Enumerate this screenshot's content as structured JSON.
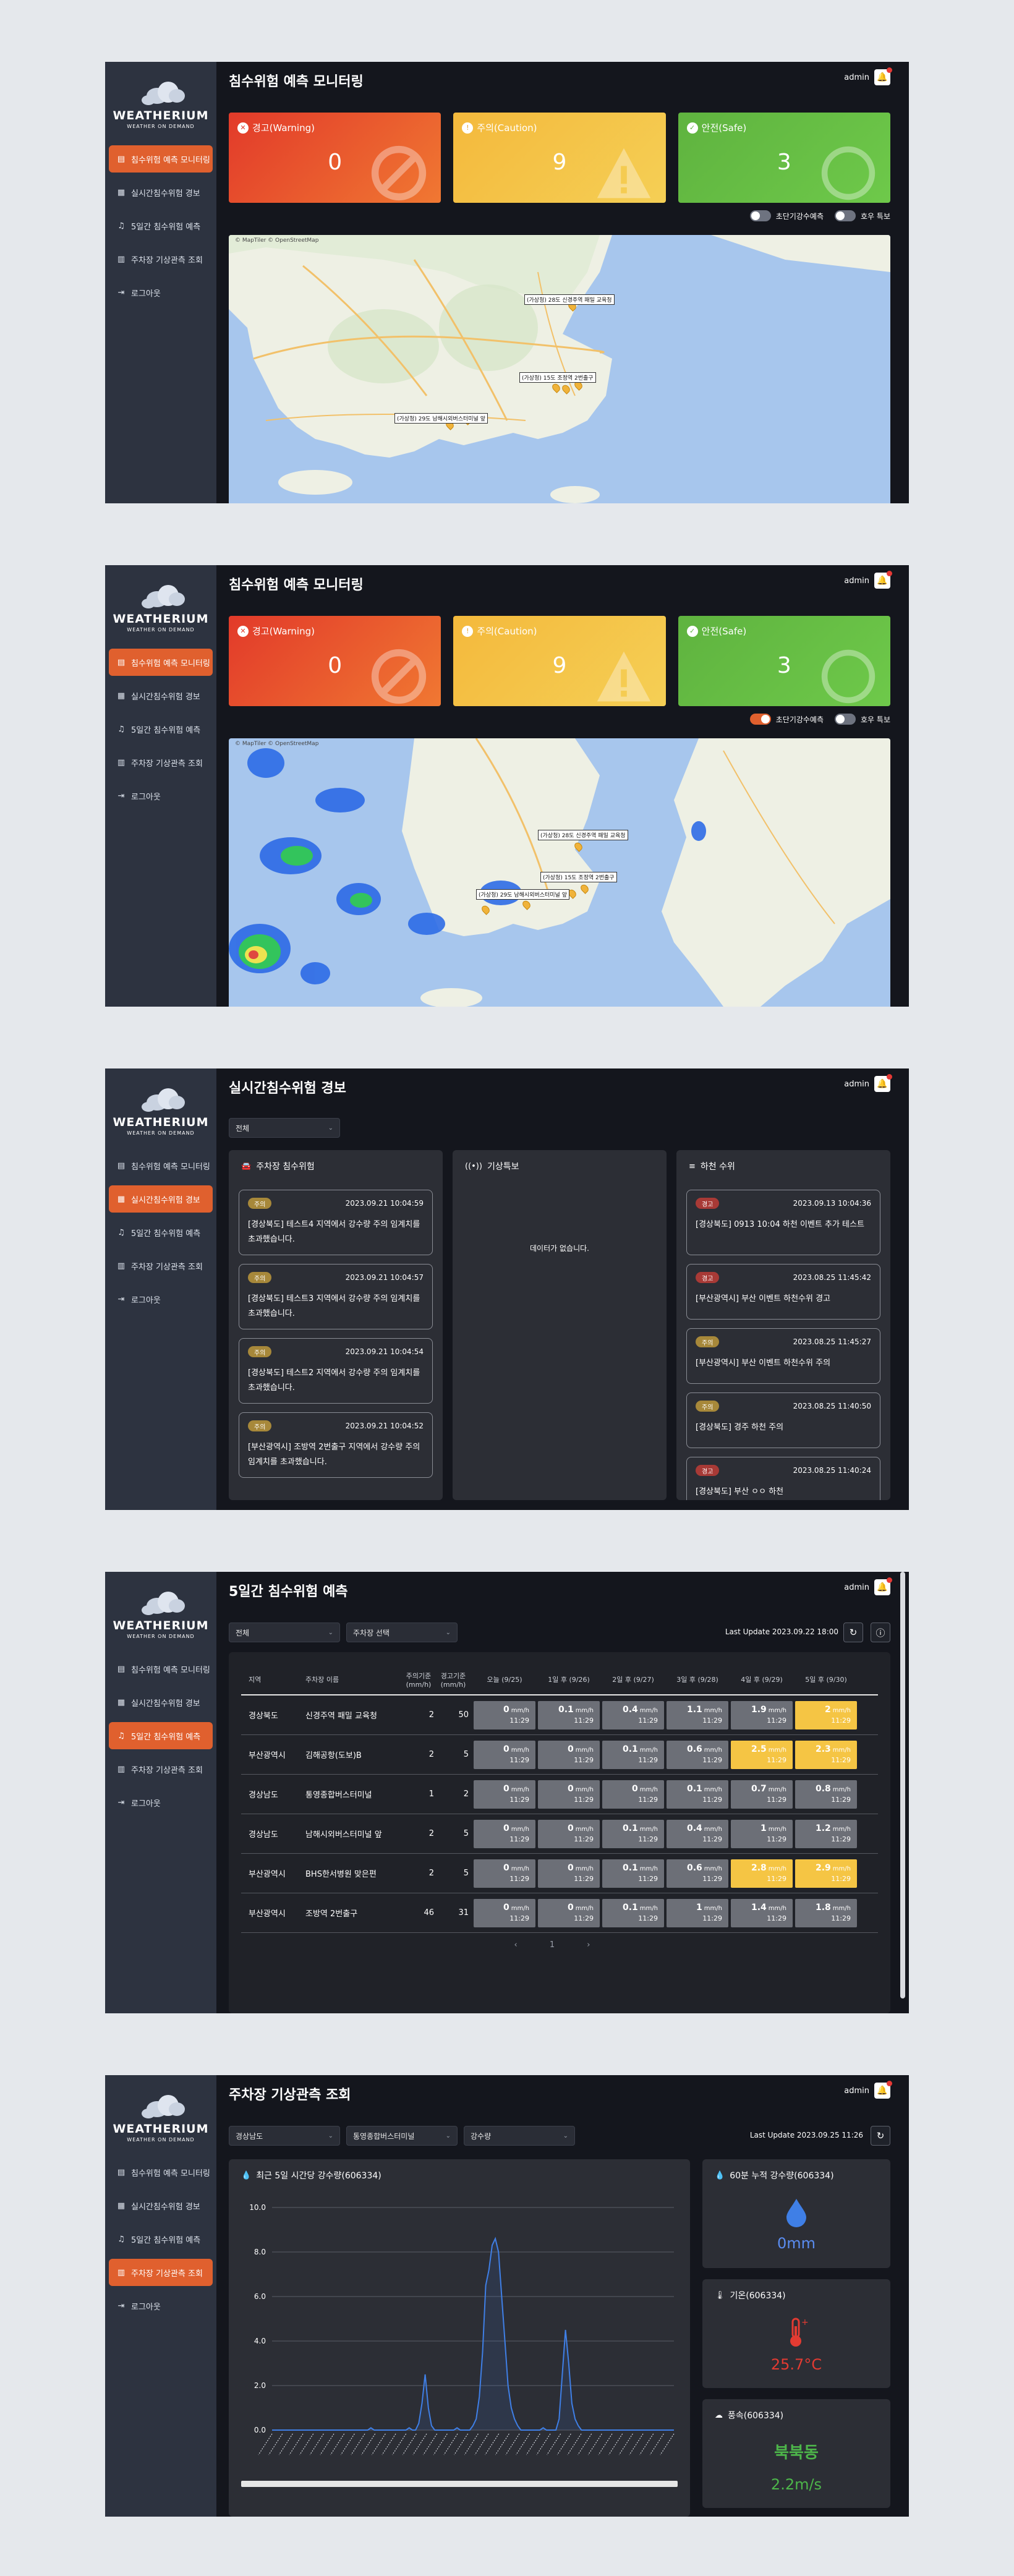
{
  "brand": {
    "name": "WEATHERIUM",
    "tagline": "WEATHER ON DEMAND"
  },
  "nav": [
    {
      "label": "침수위험 예측 모니터링"
    },
    {
      "label": "실시간침수위험 경보"
    },
    {
      "label": "5일간 침수위험 예측"
    },
    {
      "label": "주차장 기상관측 조회"
    },
    {
      "label": "로그아웃"
    }
  ],
  "user": "admin",
  "colors": {
    "accent": "#e0602e",
    "sidebar": "#2d3340",
    "warning": "#e23a2a",
    "caution": "#f5c544",
    "safe": "#5fb33f"
  },
  "monitor": {
    "title": "침수위험 예측 모니터링",
    "cards": [
      {
        "label": "경고(Warning)",
        "count": "0"
      },
      {
        "label": "주의(Caution)",
        "count": "9"
      },
      {
        "label": "안전(Safe)",
        "count": "3"
      }
    ],
    "toggle_short": "초단기강수예측",
    "toggle_heavy": "호우 특보",
    "attribution": "© MapTiler © OpenStreetMap",
    "map1_labels": [
      "(가상청) 28도 신경주역 패밀 교육청",
      "(가상청) 15도 조정역 2번출구",
      "(가상청) 29도 남해시외버스터미널 앞"
    ],
    "map2_labels": [
      "(가상청) 28도 신경주역 패밀 교육청",
      "(가상청) 15도 조정역 2번출구",
      "(가상청) 29도 남해시외버스터미널 앞"
    ]
  },
  "realtime": {
    "title": "실시간침수위험 경보",
    "filter": "전체",
    "panels": {
      "parking": "주차장 침수위험",
      "special": "기상특보",
      "river": "하천 수위"
    },
    "empty": "데이터가 없습니다.",
    "parking_alerts": [
      {
        "badge": "주의",
        "time": "2023.09.21 10:04:59",
        "text": "[경상북도] 테스트4 지역에서 강수량 주의 임계치를 초과했습니다."
      },
      {
        "badge": "주의",
        "time": "2023.09.21 10:04:57",
        "text": "[경상북도] 테스트3 지역에서 강수량 주의 임계치를 초과했습니다."
      },
      {
        "badge": "주의",
        "time": "2023.09.21 10:04:54",
        "text": "[경상북도] 테스트2 지역에서 강수량 주의 임계치를 초과했습니다."
      },
      {
        "badge": "주의",
        "time": "2023.09.21 10:04:52",
        "text": "[부산광역시] 조방역 2번출구 지역에서 강수량 주의 임계치를 초과했습니다."
      }
    ],
    "river_alerts": [
      {
        "badge": "경고",
        "level": "warn",
        "time": "2023.09.13 10:04:36",
        "text": "[경상북도] 0913 10:04 하천 이벤트 추가 테스트"
      },
      {
        "badge": "경고",
        "level": "warn",
        "time": "2023.08.25 11:45:42",
        "text": "[부산광역시] 부산 이벤트 하천수위 경고"
      },
      {
        "badge": "주의",
        "level": "caution",
        "time": "2023.08.25 11:45:27",
        "text": "[부산광역시] 부산 이벤트 하천수위 주의"
      },
      {
        "badge": "주의",
        "level": "caution",
        "time": "2023.08.25 11:40:50",
        "text": "[경상북도] 경주 하천 주의"
      },
      {
        "badge": "경고",
        "level": "warn",
        "time": "2023.08.25 11:40:24",
        "text": "[경상북도] 부산 ㅇㅇ 하천"
      }
    ]
  },
  "forecast": {
    "title": "5일간 침수위험 예측",
    "filter_region": "전체",
    "filter_lot": "주차장 선택",
    "last_update": "Last Update 2023.09.22 18:00",
    "headers": [
      "지역",
      "주차장 이름",
      "주의기준 (mm/h)",
      "경고기준 (mm/h)",
      "오늘 (9/25)",
      "1일 후 (9/26)",
      "2일 후 (9/27)",
      "3일 후 (9/28)",
      "4일 후 (9/29)",
      "5일 후 (9/30)"
    ],
    "unit": "mm/h",
    "rows": [
      {
        "region": "경상북도",
        "name": "신경주역 패밀 교육청",
        "caution": "2",
        "warning": "50",
        "days": [
          [
            "0",
            "11:29"
          ],
          [
            "0.1",
            "11:29"
          ],
          [
            "0.4",
            "11:29"
          ],
          [
            "1.1",
            "11:29"
          ],
          [
            "1.9",
            "11:29"
          ],
          [
            "2",
            "11:29"
          ]
        ],
        "hi": [
          5
        ]
      },
      {
        "region": "부산광역시",
        "name": "김해공항(도보)B",
        "caution": "2",
        "warning": "5",
        "days": [
          [
            "0",
            "11:29"
          ],
          [
            "0",
            "11:29"
          ],
          [
            "0.1",
            "11:29"
          ],
          [
            "0.6",
            "11:29"
          ],
          [
            "2.5",
            "11:29"
          ],
          [
            "2.3",
            "11:29"
          ]
        ],
        "hi": [
          4,
          5
        ]
      },
      {
        "region": "경상남도",
        "name": "통영종합버스터미널",
        "caution": "1",
        "warning": "2",
        "days": [
          [
            "0",
            "11:29"
          ],
          [
            "0",
            "11:29"
          ],
          [
            "0",
            "11:29"
          ],
          [
            "0.1",
            "11:29"
          ],
          [
            "0.7",
            "11:29"
          ],
          [
            "0.8",
            "11:29"
          ]
        ],
        "hi": []
      },
      {
        "region": "경상남도",
        "name": "남해시외버스터미널 앞",
        "caution": "2",
        "warning": "5",
        "days": [
          [
            "0",
            "11:29"
          ],
          [
            "0",
            "11:29"
          ],
          [
            "0.1",
            "11:29"
          ],
          [
            "0.4",
            "11:29"
          ],
          [
            "1",
            "11:29"
          ],
          [
            "1.2",
            "11:29"
          ]
        ],
        "hi": []
      },
      {
        "region": "부산광역시",
        "name": "BHS한서병원 맞은편",
        "caution": "2",
        "warning": "5",
        "days": [
          [
            "0",
            "11:29"
          ],
          [
            "0",
            "11:29"
          ],
          [
            "0.1",
            "11:29"
          ],
          [
            "0.6",
            "11:29"
          ],
          [
            "2.8",
            "11:29"
          ],
          [
            "2.9",
            "11:29"
          ]
        ],
        "hi": [
          4,
          5
        ]
      },
      {
        "region": "부산광역시",
        "name": "조방역 2번출구",
        "caution": "46",
        "warning": "31",
        "days": [
          [
            "0",
            "11:29"
          ],
          [
            "0",
            "11:29"
          ],
          [
            "0.1",
            "11:29"
          ],
          [
            "1",
            "11:29"
          ],
          [
            "1.4",
            "11:29"
          ],
          [
            "1.8",
            "11:29"
          ]
        ],
        "hi": []
      }
    ],
    "pager": "‹ 1 ›"
  },
  "parking_weather": {
    "title": "주차장 기상관측 조회",
    "filter_region": "경상남도",
    "filter_lot": "통영종합버스터미널",
    "filter_var": "강수량",
    "last_update": "Last Update 2023.09.25 11:26",
    "chart_title": "최근 5일 시간당 강수량(606334)",
    "rain_title": "60분 누적 강수량(606334)",
    "rain_value": "0mm",
    "temp_title": "기온(606334)",
    "temp_value": "25.7°C",
    "wind_title": "풍속(606334)",
    "wind_dir": "북북동",
    "wind_value": "2.2m/s"
  },
  "chart_data": {
    "type": "line",
    "title": "최근 5일 시간당 강수량(606334)",
    "ylim": [
      0,
      10
    ],
    "yticks": [
      "0.0",
      "2.0",
      "4.0",
      "6.0",
      "8.0",
      "10.0"
    ],
    "values": [
      0,
      0,
      0,
      0,
      0,
      0,
      0,
      0,
      0,
      0,
      0,
      0,
      0,
      0,
      0,
      0,
      0,
      0,
      0,
      0,
      0,
      0,
      0,
      0,
      0,
      0,
      0,
      0,
      0,
      0,
      0,
      0.1,
      0,
      0,
      0,
      0,
      0,
      0,
      0,
      0,
      0,
      0,
      0,
      0.1,
      0,
      0,
      0.3,
      1.2,
      2.5,
      1.0,
      0.2,
      0,
      0,
      0,
      0,
      0,
      0,
      0,
      0.1,
      0,
      0,
      0,
      0,
      0.2,
      0.5,
      1.5,
      3.5,
      6.5,
      7.2,
      8.3,
      8.6,
      8.0,
      6.0,
      4.0,
      2.0,
      1.0,
      0.5,
      0.2,
      0,
      0,
      0,
      0,
      0,
      0,
      0,
      0.1,
      0,
      0,
      0,
      0,
      0.5,
      2.5,
      4.5,
      3.0,
      1.2,
      0.5,
      0.2,
      0,
      0,
      0,
      0,
      0,
      0,
      0,
      0,
      0,
      0,
      0,
      0,
      0,
      0,
      0,
      0,
      0,
      0,
      0,
      0,
      0,
      0,
      0,
      0,
      0,
      0,
      0,
      0,
      0,
      0
    ]
  }
}
